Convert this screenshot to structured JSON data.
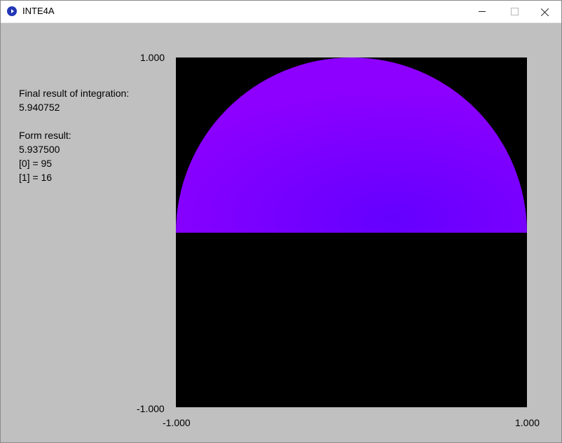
{
  "window": {
    "title": "INTE4A",
    "icon": "app-icon",
    "controls": {
      "minimize": "minimize-icon",
      "maximize": "maximize-icon",
      "close": "close-icon"
    }
  },
  "results": {
    "integration_label": "Final result of integration:",
    "integration_value": "5.940752",
    "form_label": "Form result:",
    "form_value": "5.937500",
    "counts": [
      "[0] = 95",
      "[1] = 16"
    ]
  },
  "plot": {
    "y_max_label": "1.000",
    "y_min_label": "-1.000",
    "x_min_label": "-1.000",
    "x_max_label": "1.000",
    "background": "#000000",
    "fill_colors": [
      "#8d00ff",
      "#6400ff"
    ],
    "region": "upper-half-disc"
  }
}
